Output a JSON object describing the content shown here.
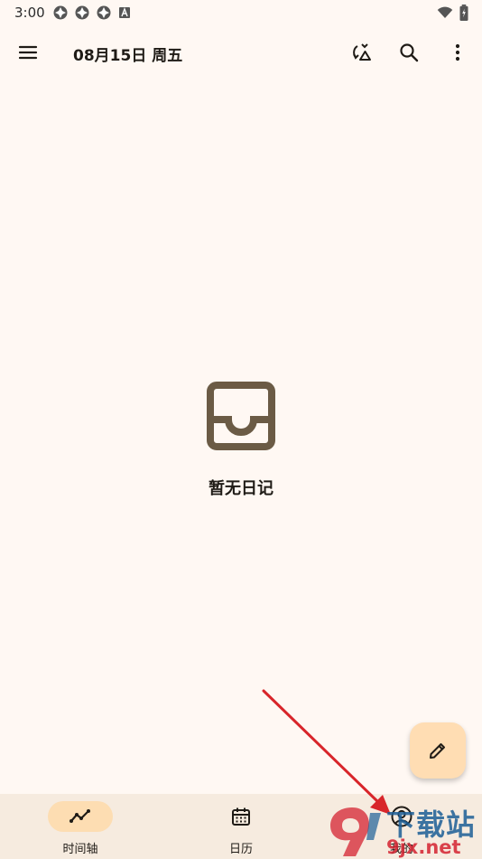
{
  "status_bar": {
    "time": "3:00",
    "left_icons": [
      "sync-icon",
      "sync-icon",
      "sync-icon",
      "text-a-icon"
    ],
    "right_icons": [
      "wifi-icon",
      "battery-icon"
    ]
  },
  "top_bar": {
    "title": "08月15日 周五",
    "icons": [
      "menu-icon",
      "refresh-sync-icon",
      "search-icon",
      "more-vert-icon"
    ]
  },
  "empty_state": {
    "icon": "inbox-icon",
    "message": "暂无日记"
  },
  "fab": {
    "icon": "pencil-icon"
  },
  "bottom_nav": {
    "items": [
      {
        "label": "时间轴",
        "icon": "timeline-icon",
        "active": true
      },
      {
        "label": "日历",
        "icon": "calendar-icon",
        "active": false
      },
      {
        "label": "我的",
        "icon": "account-icon",
        "active": false
      }
    ]
  },
  "watermark": {
    "text_top": "下载站",
    "text_bottom": "9jx.net"
  },
  "colors": {
    "background": "#FFF8F3",
    "nav_background": "#F6EBDF",
    "accent": "#FFDDB3",
    "icon_brown": "#6B5B45",
    "arrow": "#D8252A"
  }
}
